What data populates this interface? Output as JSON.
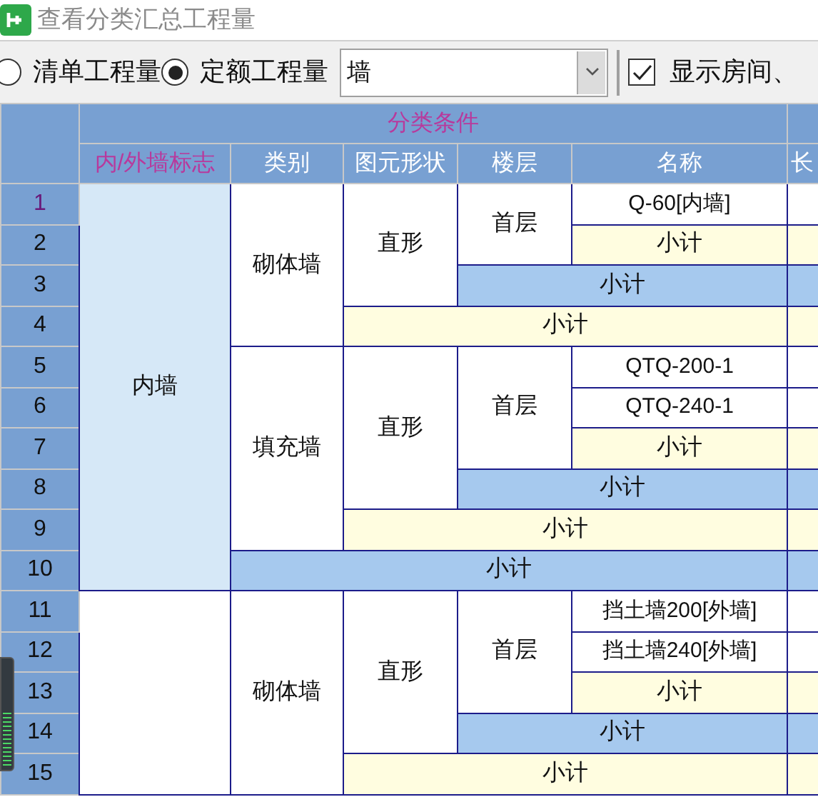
{
  "window": {
    "title": "查看分类汇总工程量"
  },
  "toolbar": {
    "radios": [
      {
        "label": "清单工程量",
        "selected": false
      },
      {
        "label": "定额工程量",
        "selected": true
      }
    ],
    "combo": {
      "value": "墙"
    },
    "checkbox": {
      "label": "显示房间、",
      "checked": true
    }
  },
  "table": {
    "group_header": "分类条件",
    "columns": [
      {
        "label": "内/外墙标志",
        "highlighted": true
      },
      {
        "label": "类别",
        "highlighted": false
      },
      {
        "label": "图元形状",
        "highlighted": false
      },
      {
        "label": "楼层",
        "highlighted": false
      },
      {
        "label": "名称",
        "highlighted": false
      },
      {
        "label": "长",
        "highlighted": false
      }
    ],
    "row_numbers": [
      {
        "label": "1",
        "selected": true
      },
      {
        "label": "2",
        "selected": false
      },
      {
        "label": "3",
        "selected": false
      },
      {
        "label": "4",
        "selected": false
      },
      {
        "label": "5",
        "selected": false
      },
      {
        "label": "6",
        "selected": false
      },
      {
        "label": "7",
        "selected": false
      },
      {
        "label": "8",
        "selected": false
      },
      {
        "label": "9",
        "selected": false
      },
      {
        "label": "10",
        "selected": false
      },
      {
        "label": "11",
        "selected": false
      },
      {
        "label": "12",
        "selected": false
      },
      {
        "label": "13",
        "selected": false
      },
      {
        "label": "14",
        "selected": false
      },
      {
        "label": "15",
        "selected": false
      }
    ],
    "groups": [
      {
        "label": "内墙",
        "selected": true,
        "subtotal": "小计",
        "children": [
          {
            "label": "砌体墙",
            "subtotal": "小计",
            "children": [
              {
                "label": "直形",
                "subtotal": "小计",
                "children": [
                  {
                    "label": "首层",
                    "subtotal": "小计",
                    "children": [
                      {
                        "label": "Q-60[内墙]"
                      }
                    ]
                  }
                ]
              }
            ]
          },
          {
            "label": "填充墙",
            "subtotal": "小计",
            "children": [
              {
                "label": "直形",
                "subtotal": "小计",
                "children": [
                  {
                    "label": "首层",
                    "subtotal": "小计",
                    "children": [
                      {
                        "label": "QTQ-200-1"
                      },
                      {
                        "label": "QTQ-240-1"
                      }
                    ]
                  }
                ]
              }
            ]
          }
        ]
      },
      {
        "selected": false,
        "children": [
          {
            "label": "砌体墙",
            "subtotal": "小计",
            "children": [
              {
                "label": "直形",
                "subtotal": "小计",
                "children": [
                  {
                    "label": "首层",
                    "subtotal": "小计",
                    "children": [
                      {
                        "label": "挡土墙200[外墙]"
                      },
                      {
                        "label": "挡土墙240[外墙]"
                      }
                    ]
                  }
                ]
              }
            ]
          }
        ]
      }
    ]
  }
}
